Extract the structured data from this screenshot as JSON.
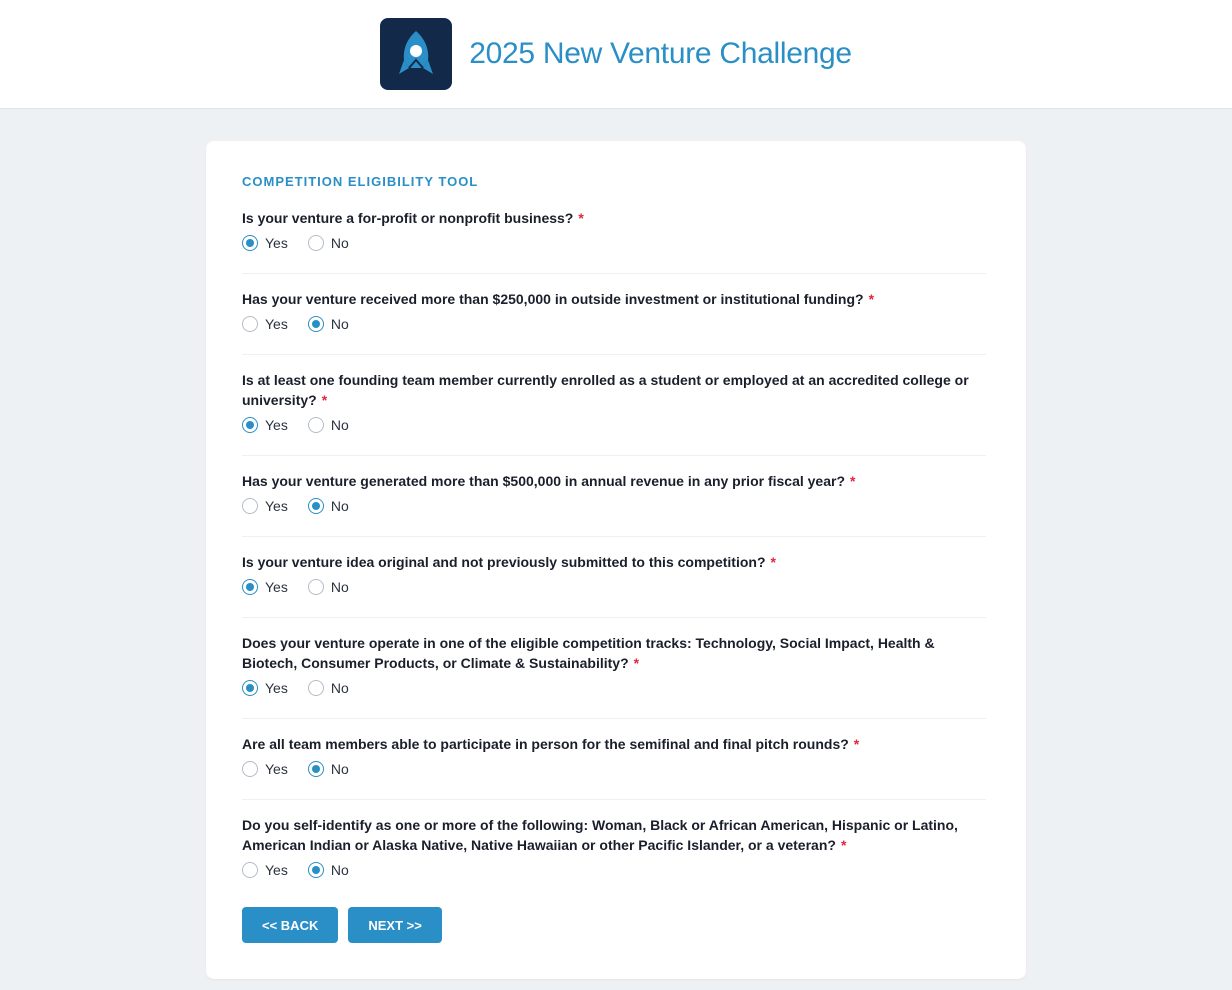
{
  "header": {
    "title": "2025 New Venture Challenge",
    "logo_icon": "rocket-icon",
    "logo_bg": "#12294a"
  },
  "form": {
    "section_title": "COMPETITION ELIGIBILITY TOOL",
    "required_mark": "*",
    "questions": [
      {
        "text": "Is your venture a for-profit or nonprofit business?",
        "selected": "Yes"
      },
      {
        "text": "Has your venture received more than $250,000 in outside investment or institutional funding?",
        "selected": "No"
      },
      {
        "text": "Is at least one founding team member currently enrolled as a student or employed at an accredited college or university?",
        "selected": "Yes"
      },
      {
        "text": "Has your venture generated more than $500,000 in annual revenue in any prior fiscal year?",
        "selected": "No"
      },
      {
        "text": "Is your venture idea original and not previously submitted to this competition?",
        "selected": "Yes"
      },
      {
        "text": "Does your venture operate in one of the eligible competition tracks: Technology, Social Impact, Health & Biotech, Consumer Products, or Climate & Sustainability?",
        "selected": "Yes"
      },
      {
        "text": "Are all team members able to participate in person for the semifinal and final pitch rounds?",
        "selected": "No"
      },
      {
        "text": "Do you self-identify as one or more of the following: Woman, Black or African American, Hispanic or Latino, American Indian or Alaska Native, Native Hawaiian or other Pacific Islander, or a veteran?",
        "selected": "No"
      }
    ],
    "options": [
      "Yes",
      "No"
    ],
    "back_label": "<< BACK",
    "next_label": "NEXT >>"
  },
  "colors": {
    "accent": "#2a8fc6",
    "required": "#e0283c",
    "background": "#eef1f4"
  }
}
